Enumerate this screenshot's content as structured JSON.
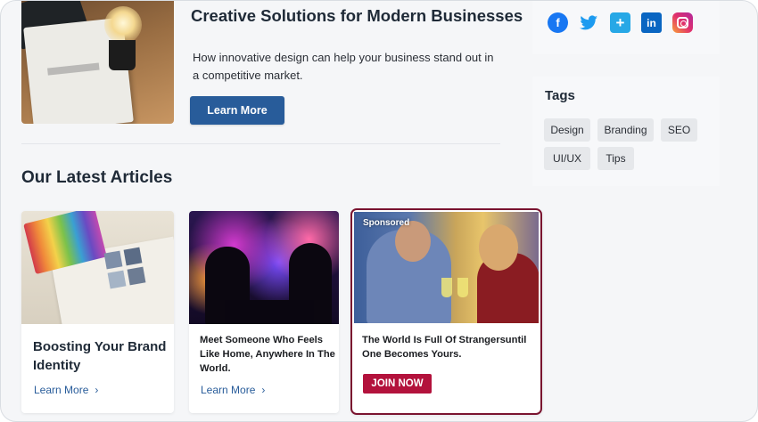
{
  "featured": {
    "title": "Creative Solutions for Modern Businesses",
    "text": "How innovative design can help your business stand out in a competitive market.",
    "button": "Learn More"
  },
  "section_title": "Our Latest Articles",
  "sidebar": {
    "social": [
      {
        "icon": "facebook-icon",
        "glyph": "f",
        "color": "#1877f2"
      },
      {
        "icon": "twitter-icon",
        "glyph": "🐦",
        "color": "#1d9bf0"
      },
      {
        "icon": "plus-icon",
        "glyph": "+",
        "color": "#27a8e6"
      },
      {
        "icon": "linkedin-icon",
        "glyph": "in",
        "color": "#0a66c2"
      },
      {
        "icon": "instagram-icon",
        "glyph": "",
        "color": "#e1306c"
      }
    ],
    "tags_title": "Tags",
    "tags": [
      "Design",
      "Branding",
      "SEO",
      "UI/UX",
      "Tips"
    ]
  },
  "articles": [
    {
      "title": "Boosting Your Brand Identity",
      "link": "Learn More"
    },
    {
      "title": "Meet Someone Who Feels Like Home, Anywhere In The World.",
      "link": "Learn More"
    }
  ],
  "sponsored": {
    "badge": "Sponsored",
    "title": "The World Is Full Of Strangersuntil One Becomes Yours.",
    "button": "JOIN NOW",
    "accent": "#b3123c"
  }
}
